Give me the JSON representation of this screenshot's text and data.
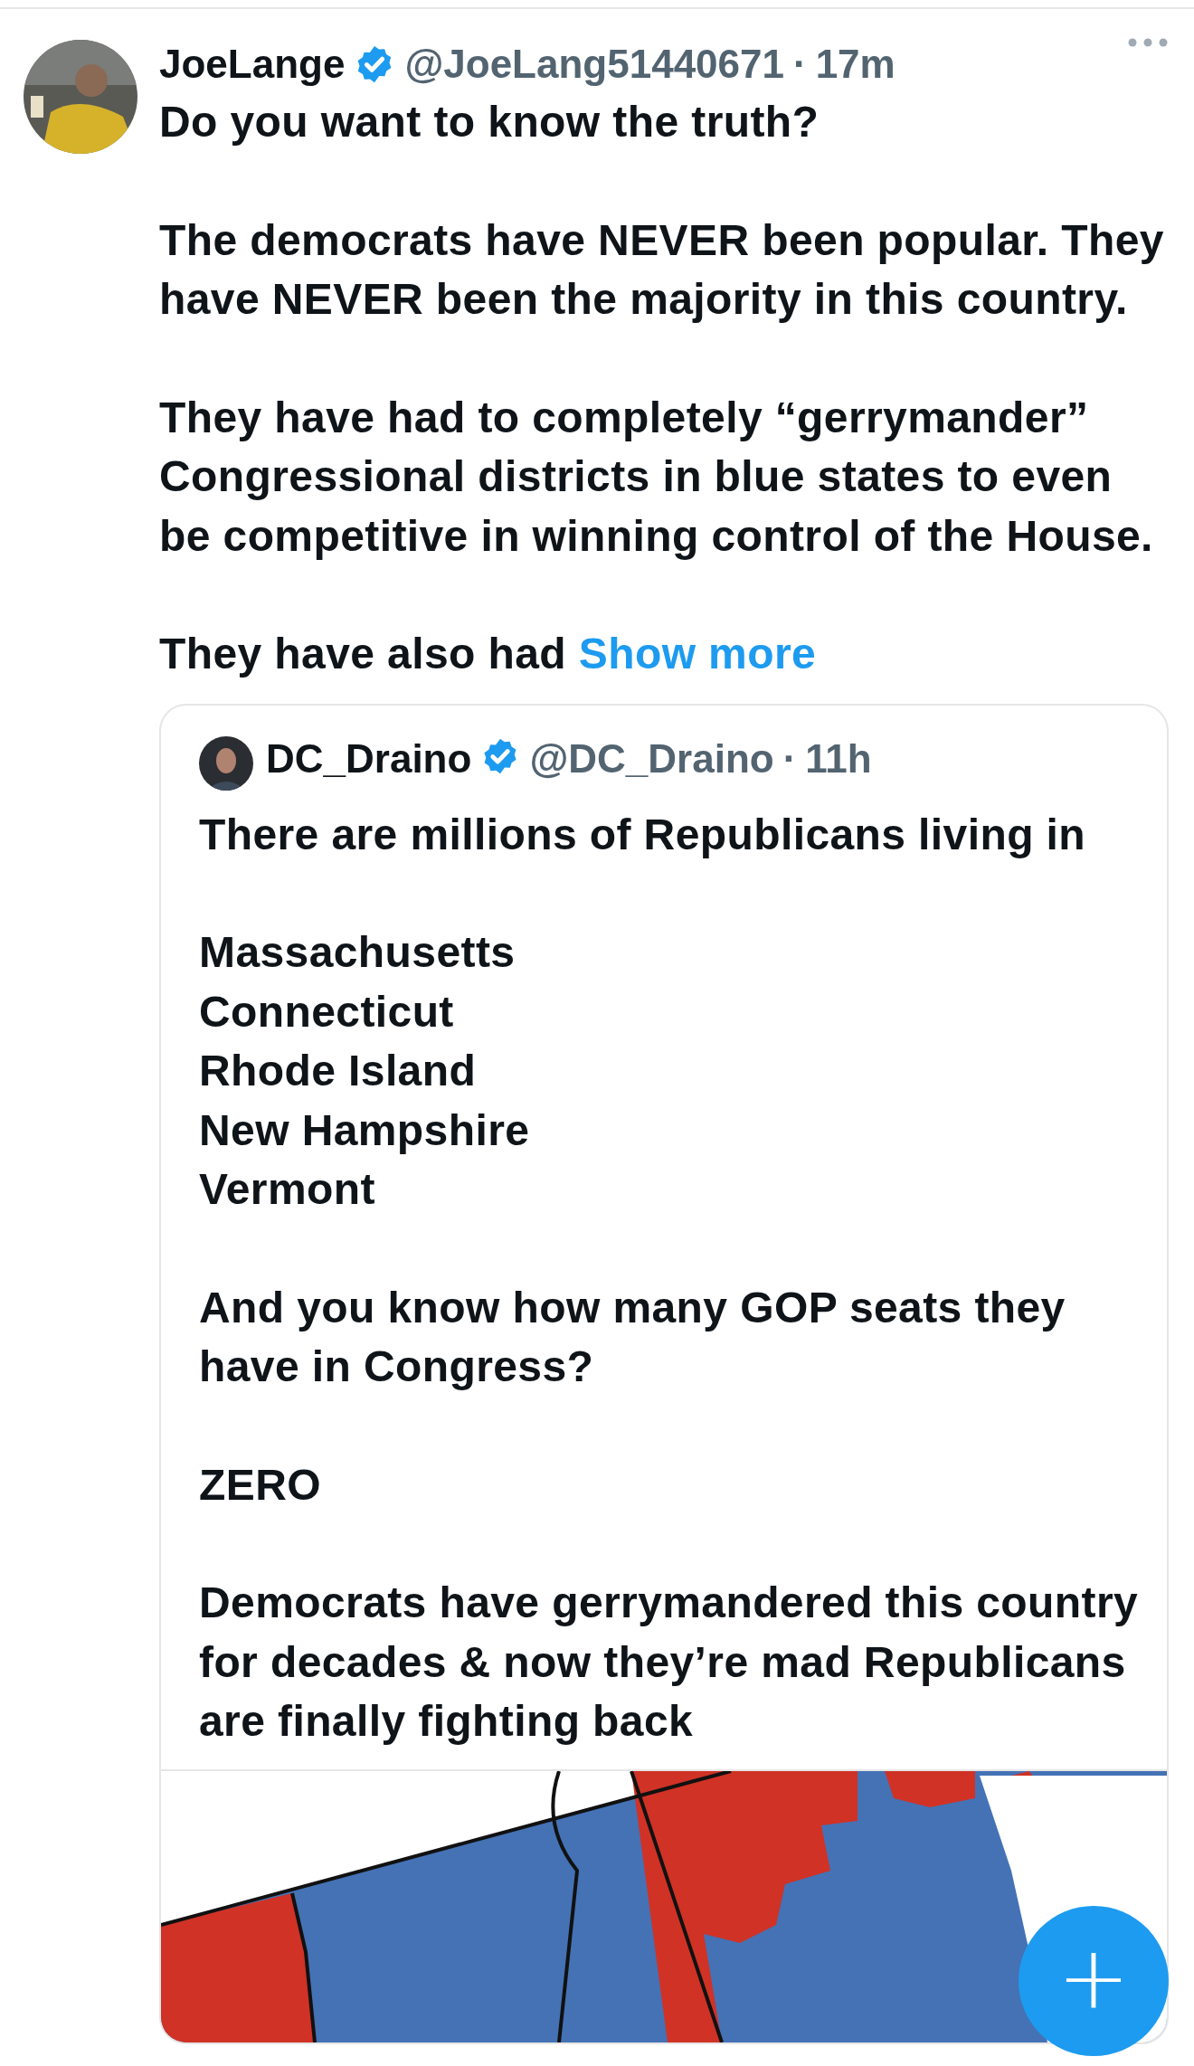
{
  "tweet": {
    "author": {
      "name": "JoeLange",
      "verified": true,
      "handle": "@JoeLang51440671",
      "separator": "·",
      "time": "17m"
    },
    "paragraphs": [
      "Do you want to know the truth?",
      "The democrats have NEVER been popular. They have NEVER been the majority in this country.",
      "They have had to completely “gerrymander” Congressional districts in blue states to even be competitive in winning control of the House."
    ],
    "truncated_text": "They have also had",
    "show_more": "Show more",
    "quote": {
      "author": {
        "name": "DC_Draino",
        "verified": true,
        "handle": "@DC_Draino",
        "separator": "·",
        "time": "11h"
      },
      "paragraphs": [
        "There are millions of Republicans living in",
        "Massachusetts\nConnecticut\nRhode Island\nNew Hampshire\nVermont",
        "And you know how many GOP seats they have in Congress?",
        "ZERO",
        "Democrats have gerrymandered this country for decades & now they’re mad Republicans are finally fighting back"
      ]
    }
  },
  "compose_button": {
    "label": "+"
  }
}
